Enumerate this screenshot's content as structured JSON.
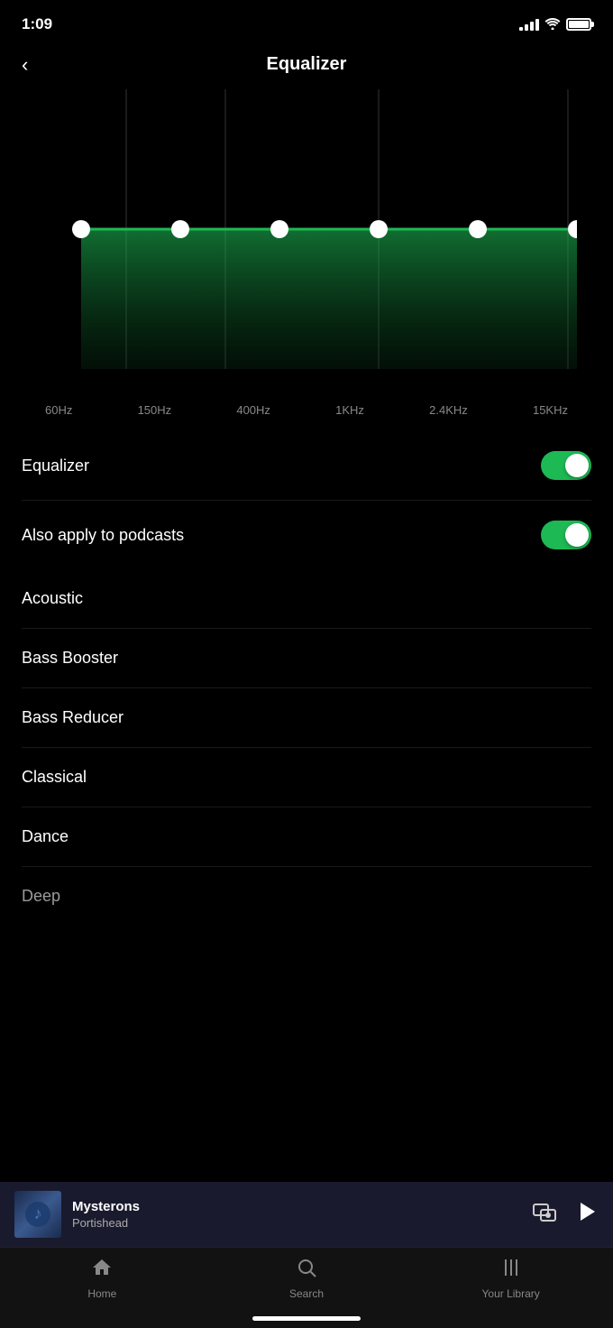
{
  "status": {
    "time": "1:09",
    "signal_bars": [
      4,
      7,
      10,
      13
    ],
    "battery_percent": 100
  },
  "header": {
    "title": "Equalizer",
    "back_label": "<"
  },
  "eq": {
    "frequencies": [
      "60Hz",
      "150Hz",
      "400Hz",
      "1KHz",
      "2.4KHz",
      "15KHz"
    ],
    "points": [
      0,
      0,
      0,
      0,
      0,
      0
    ],
    "accent_color": "#1db954"
  },
  "toggles": [
    {
      "label": "Equalizer",
      "enabled": true
    },
    {
      "label": "Also apply to podcasts",
      "enabled": true
    }
  ],
  "presets": [
    {
      "label": "Acoustic"
    },
    {
      "label": "Bass Booster"
    },
    {
      "label": "Bass Reducer"
    },
    {
      "label": "Classical"
    },
    {
      "label": "Dance"
    },
    {
      "label": "Deep"
    }
  ],
  "now_playing": {
    "track": "Mysterons",
    "artist": "Portishead"
  },
  "bottom_nav": {
    "items": [
      {
        "key": "home",
        "label": "Home",
        "active": false
      },
      {
        "key": "search",
        "label": "Search",
        "active": false
      },
      {
        "key": "library",
        "label": "Your Library",
        "active": false
      }
    ]
  }
}
